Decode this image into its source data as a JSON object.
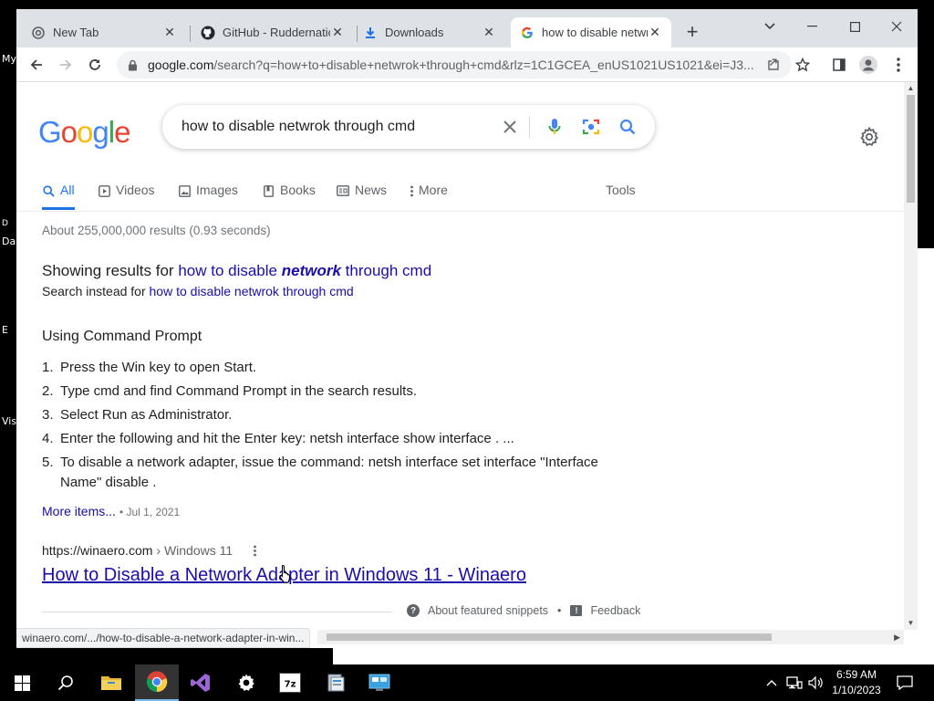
{
  "desktop": {
    "labels": [
      "My",
      "D",
      "Da",
      "E",
      "Vis"
    ]
  },
  "browser": {
    "tabs": [
      {
        "title": "New Tab",
        "icon": "chrome-icon"
      },
      {
        "title": "GitHub - Ruddernation",
        "icon": "github-icon"
      },
      {
        "title": "Downloads",
        "icon": "download-icon"
      },
      {
        "title": "how to disable netwrok",
        "icon": "google-icon"
      }
    ],
    "url_host": "google.com",
    "url_rest": "/search?q=how+to+disable+netwrok+through+cmd&rlz=1C1GCEA_enUS1021US1021&ei=J3...",
    "status_url": "winaero.com/.../how-to-disable-a-network-adapter-in-win..."
  },
  "search": {
    "logo_letters": [
      "G",
      "o",
      "o",
      "g",
      "l",
      "e"
    ],
    "query": "how to disable netwrok through cmd",
    "tabs": [
      {
        "label": "All",
        "icon": "search-icon",
        "active": true
      },
      {
        "label": "Videos",
        "icon": "video-icon"
      },
      {
        "label": "Images",
        "icon": "image-icon"
      },
      {
        "label": "Books",
        "icon": "book-icon"
      },
      {
        "label": "News",
        "icon": "news-icon"
      },
      {
        "label": "More",
        "icon": "more-vert-icon"
      }
    ],
    "tools_label": "Tools",
    "stats": "About 255,000,000 results (0.93 seconds)"
  },
  "correction": {
    "prefix": "Showing results for",
    "corrected_a": "how to disable",
    "corrected_b": "network",
    "corrected_c": "through cmd",
    "instead_prefix": "Search instead for",
    "instead_query": "how to disable netwrok through cmd"
  },
  "snippet": {
    "heading": "Using Command Prompt",
    "steps": [
      "Press the Win key to open Start.",
      "Type cmd and find Command Prompt in the search results.",
      "Select Run as Administrator.",
      "Enter the following and hit the Enter key: netsh interface show interface . ...",
      "To disable a network adapter, issue the command: netsh interface set interface \"Interface Name\" disable ."
    ],
    "more_items": "More items...",
    "date": "• Jul 1, 2021",
    "cite_url": "https://winaero.com",
    "cite_path": "› Windows 11",
    "result_title": "How to Disable a Network Adapter in Windows 11 - Winaero",
    "about_label": "About featured snippets",
    "feedback_label": "Feedback"
  },
  "taskbar": {
    "time": "6:59 AM",
    "date": "1/10/2023"
  },
  "colors": {
    "google_blue": "#4285F4",
    "google_red": "#EA4335",
    "google_yellow": "#FBBC05",
    "google_green": "#34A853",
    "link": "#1a0dab",
    "active_tab": "#1a73e8"
  }
}
